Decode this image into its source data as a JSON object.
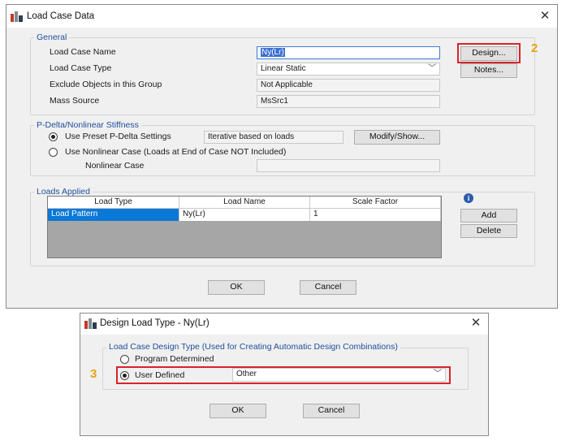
{
  "load_case_dialog": {
    "title": "Load Case Data",
    "general": {
      "legend": "General",
      "name_label": "Load Case Name",
      "name_value": "Ny(Lr)",
      "type_label": "Load Case Type",
      "type_value": "Linear Static",
      "exclude_label": "Exclude Objects in this Group",
      "exclude_value": "Not Applicable",
      "mass_label": "Mass Source",
      "mass_value": "MsSrc1",
      "design_button": "Design...",
      "notes_button": "Notes..."
    },
    "pdelta": {
      "legend": "P-Delta/Nonlinear Stiffness",
      "preset_label": "Use Preset P-Delta Settings",
      "preset_value": "Iterative based on loads",
      "modify_button": "Modify/Show...",
      "nonlinear_label": "Use Nonlinear Case  (Loads at End of Case NOT Included)",
      "nonlinear_case_label": "Nonlinear Case",
      "nonlinear_case_value": ""
    },
    "loads": {
      "legend": "Loads Applied",
      "columns": [
        "Load Type",
        "Load Name",
        "Scale Factor"
      ],
      "rows": [
        {
          "load_type": "Load Pattern",
          "load_name": "Ny(Lr)",
          "scale_factor": "1"
        }
      ],
      "add_button": "Add",
      "delete_button": "Delete"
    },
    "ok_button": "OK",
    "cancel_button": "Cancel",
    "step_marker": "2"
  },
  "design_dialog": {
    "title": "Design Load Type - Ny(Lr)",
    "legend": "Load Case Design Type  (Used for Creating Automatic Design Combinations)",
    "program_label": "Program Determined",
    "user_label": "User Defined",
    "user_value": "Other",
    "ok_button": "OK",
    "cancel_button": "Cancel",
    "step_marker": "3"
  },
  "colors": {
    "highlight": "#d8232a",
    "step_marker": "#e8a317",
    "legend_text": "#1f4e9b",
    "selection": "#0a78d7"
  }
}
